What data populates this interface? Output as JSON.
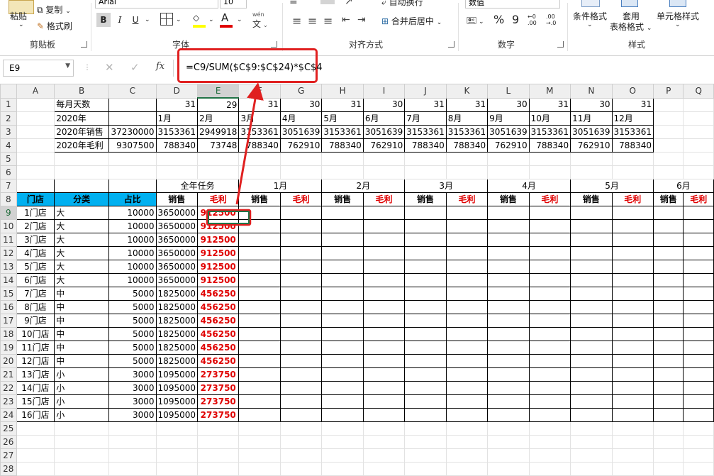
{
  "ribbon": {
    "paste": "粘贴",
    "copy": "复制",
    "format_painter": "格式刷",
    "clipboard_group": "剪贴板",
    "font_name": "Arial",
    "font_size": "10",
    "bold": "B",
    "italic": "I",
    "underline": "U",
    "font_color_letter": "A",
    "wen": "wén",
    "font_group": "字体",
    "merge_center": "合并后居中",
    "wrap_text": "自动换行",
    "align_group": "对齐方式",
    "number_format": "数值",
    "percent": "%",
    "comma": "9",
    "number_group": "数字",
    "conditional_format": "条件格式",
    "table_format_1": "套用",
    "table_format_2": "表格格式",
    "cell_style": "单元格样式",
    "styles_group": "样式"
  },
  "formula_bar": {
    "name_box": "E9",
    "fx": "fx",
    "formula": "=C9/SUM($C$9:$C$24)*$C$4"
  },
  "columns": [
    "A",
    "B",
    "C",
    "D",
    "E",
    "F",
    "G",
    "H",
    "I",
    "J",
    "K",
    "L",
    "M",
    "N",
    "O",
    "P",
    "Q"
  ],
  "rows": {
    "r1": {
      "label": "每月天数",
      "days": [
        "31",
        "29",
        "31",
        "30",
        "31",
        "30",
        "31",
        "31",
        "30",
        "31",
        "30",
        "31"
      ]
    },
    "r2": {
      "label": "2020年",
      "months": [
        "1月",
        "2月",
        "3月",
        "4月",
        "5月",
        "6月",
        "7月",
        "8月",
        "9月",
        "10月",
        "11月",
        "12月"
      ]
    },
    "r3": {
      "label": "2020年销售",
      "total": "37230000",
      "values": [
        "3153361",
        "2949918",
        "3153361",
        "3051639",
        "3153361",
        "3051639",
        "3153361",
        "3153361",
        "3051639",
        "3153361",
        "3051639",
        "3153361"
      ]
    },
    "r4": {
      "label": "2020年毛利",
      "total": "9307500",
      "values": [
        "788340",
        "73748",
        "788340",
        "762910",
        "788340",
        "762910",
        "788340",
        "788340",
        "762910",
        "788340",
        "762910",
        "788340"
      ]
    }
  },
  "header7": {
    "annual": "全年任务",
    "m1": "1月",
    "m2": "2月",
    "m3": "3月",
    "m4": "4月",
    "m5": "5月",
    "m6": "6月"
  },
  "header8": {
    "store": "门店",
    "category": "分类",
    "share": "占比",
    "sales": "销售",
    "profit": "毛利"
  },
  "stores": [
    {
      "store": "1门店",
      "cat": "大",
      "share": "10000",
      "sales": "3650000",
      "profit": "912500"
    },
    {
      "store": "2门店",
      "cat": "大",
      "share": "10000",
      "sales": "3650000",
      "profit": "912500"
    },
    {
      "store": "3门店",
      "cat": "大",
      "share": "10000",
      "sales": "3650000",
      "profit": "912500"
    },
    {
      "store": "4门店",
      "cat": "大",
      "share": "10000",
      "sales": "3650000",
      "profit": "912500"
    },
    {
      "store": "5门店",
      "cat": "大",
      "share": "10000",
      "sales": "3650000",
      "profit": "912500"
    },
    {
      "store": "6门店",
      "cat": "大",
      "share": "10000",
      "sales": "3650000",
      "profit": "912500"
    },
    {
      "store": "7门店",
      "cat": "中",
      "share": "5000",
      "sales": "1825000",
      "profit": "456250"
    },
    {
      "store": "8门店",
      "cat": "中",
      "share": "5000",
      "sales": "1825000",
      "profit": "456250"
    },
    {
      "store": "9门店",
      "cat": "中",
      "share": "5000",
      "sales": "1825000",
      "profit": "456250"
    },
    {
      "store": "10门店",
      "cat": "中",
      "share": "5000",
      "sales": "1825000",
      "profit": "456250"
    },
    {
      "store": "11门店",
      "cat": "中",
      "share": "5000",
      "sales": "1825000",
      "profit": "456250"
    },
    {
      "store": "12门店",
      "cat": "中",
      "share": "5000",
      "sales": "1825000",
      "profit": "456250"
    },
    {
      "store": "13门店",
      "cat": "小",
      "share": "3000",
      "sales": "1095000",
      "profit": "273750"
    },
    {
      "store": "14门店",
      "cat": "小",
      "share": "3000",
      "sales": "1095000",
      "profit": "273750"
    },
    {
      "store": "15门店",
      "cat": "小",
      "share": "3000",
      "sales": "1095000",
      "profit": "273750"
    },
    {
      "store": "16门店",
      "cat": "小",
      "share": "3000",
      "sales": "1095000",
      "profit": "273750"
    }
  ],
  "colors": {
    "accent_green": "#217346",
    "header_blue": "#00b0f0",
    "annotation_red": "#e02020"
  }
}
